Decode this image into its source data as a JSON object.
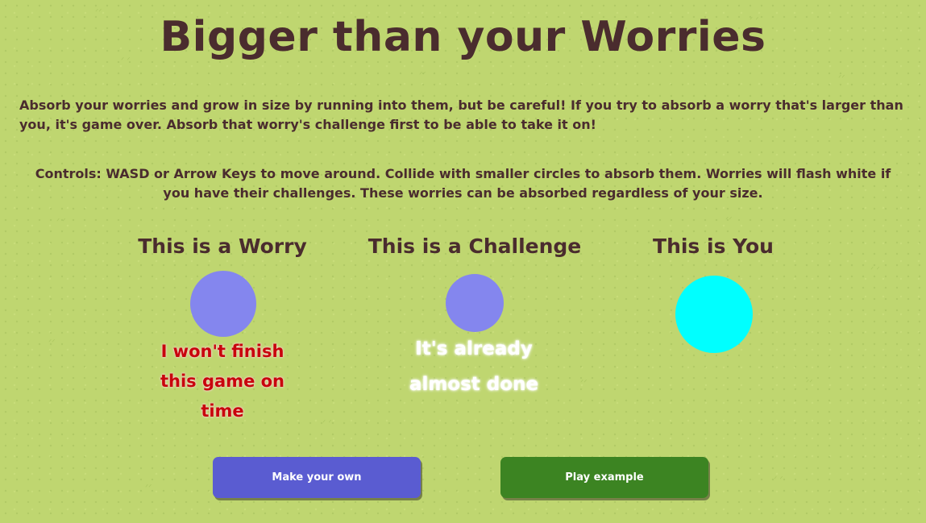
{
  "title": "Bigger than your Worries",
  "intro": "Absorb your worries and grow in size by running into them, but be careful! If you try to absorb a worry that's larger than you, it's game over. Absorb that worry's challenge first to be able to take it on!",
  "controls": "Controls: WASD or Arrow Keys to move around. Collide with smaller circles to absorb them. Worries will flash white if you have their challenges. These worries can be absorbed regardless of your size.",
  "examples": {
    "worry": {
      "heading": "This is a Worry",
      "text": "I won't finish this game on time",
      "color": "#8486ee",
      "text_color": "#c8040c"
    },
    "challenge": {
      "heading": "This is a Challenge",
      "text": "It's already almost done",
      "color": "#8486ee",
      "text_color": "#ffffff"
    },
    "you": {
      "heading": "This is You",
      "color": "#00ffff"
    }
  },
  "buttons": {
    "make_own": {
      "label": "Make your own",
      "color": "#5a5cd1"
    },
    "play_example": {
      "label": "Play example",
      "color": "#3c8422"
    }
  }
}
